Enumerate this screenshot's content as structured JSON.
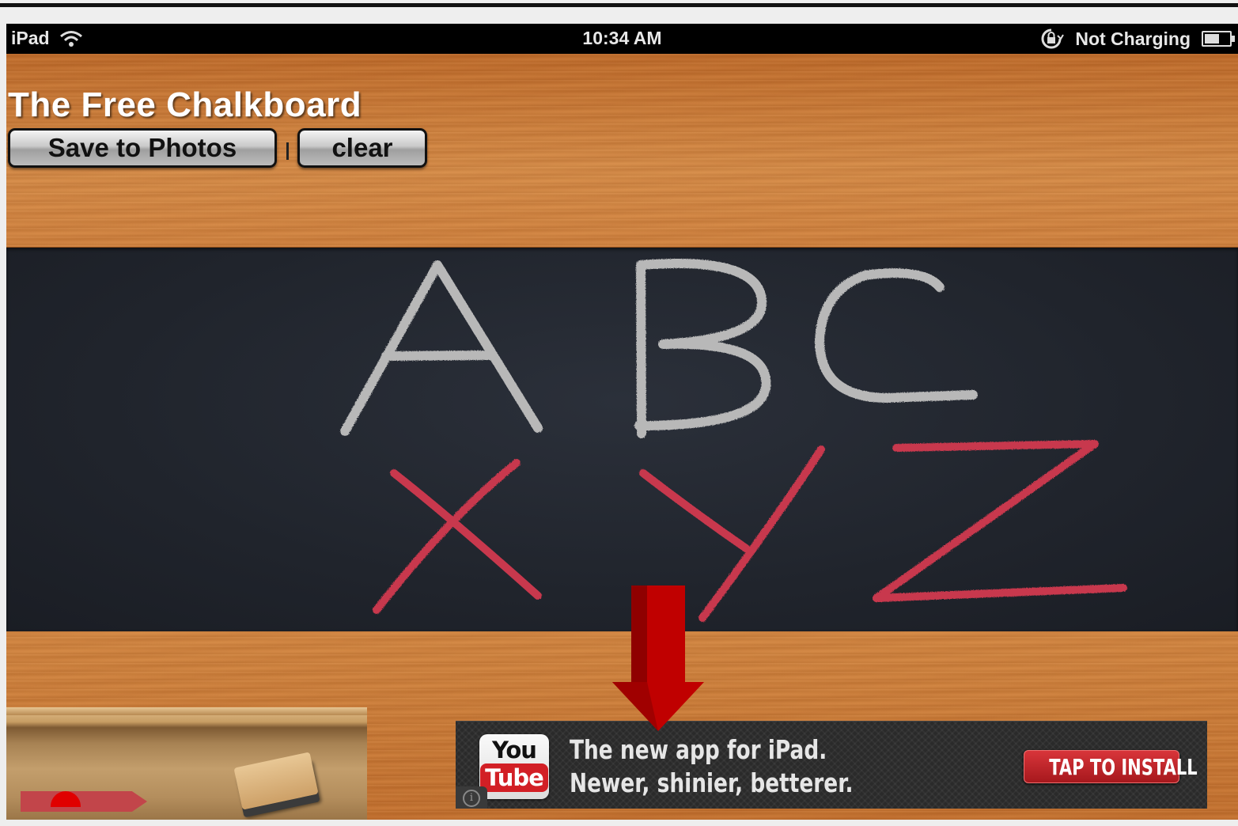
{
  "statusbar": {
    "device": "iPad",
    "time": "10:34 AM",
    "charging": "Not Charging"
  },
  "app": {
    "title": "The Free Chalkboard",
    "save_label": "Save to Photos",
    "clear_label": "clear"
  },
  "chalkboard": {
    "row1_letters": [
      "A",
      "B",
      "C"
    ],
    "row1_color": "#b8b8b8",
    "row2_letters": [
      "X",
      "Y",
      "Z"
    ],
    "row2_color": "#c8384e"
  },
  "ad": {
    "logo_top": "You",
    "logo_bottom": "Tube",
    "line1": "The new app for iPad.",
    "line2": "Newer, shinier, betterer.",
    "cta": "TAP TO INSTALL"
  },
  "colors": {
    "annotation_arrow": "#e00000",
    "wood": "#cf7c38",
    "board": "#23272f"
  }
}
